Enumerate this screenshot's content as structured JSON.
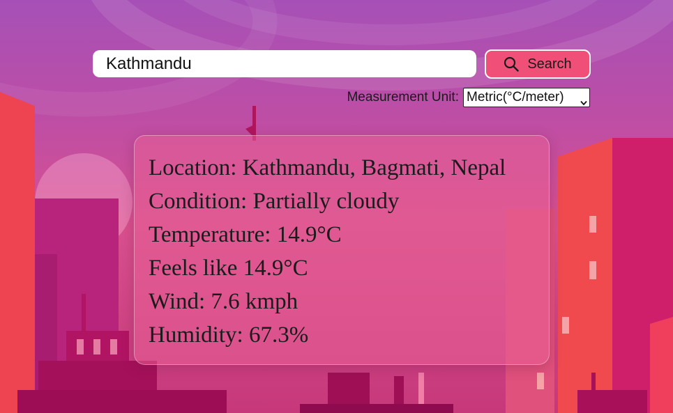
{
  "search": {
    "value": "Kathmandu",
    "button_label": "Search",
    "button_icon": "search-icon"
  },
  "units": {
    "label": "Measurement Unit:",
    "selected": "Metric(°C/meter)"
  },
  "weather": {
    "location_label": "Location:",
    "location_value": "Kathmandu, Bagmati, Nepal",
    "condition_label": "Condition:",
    "condition_value": "Partially cloudy",
    "temperature_label": "Temperature:",
    "temperature_value": "14.9°C",
    "feels_label": "Feels like",
    "feels_value": "14.9°C",
    "wind_label": "Wind:",
    "wind_value": "7.6 kmph",
    "humidity_label": "Humidity:",
    "humidity_value": "67.3%"
  },
  "colors": {
    "accent_button": "#f04f78",
    "sky_top": "#a650b7",
    "building_red": "#f04a4f",
    "building_magenta": "#c81c6e"
  }
}
